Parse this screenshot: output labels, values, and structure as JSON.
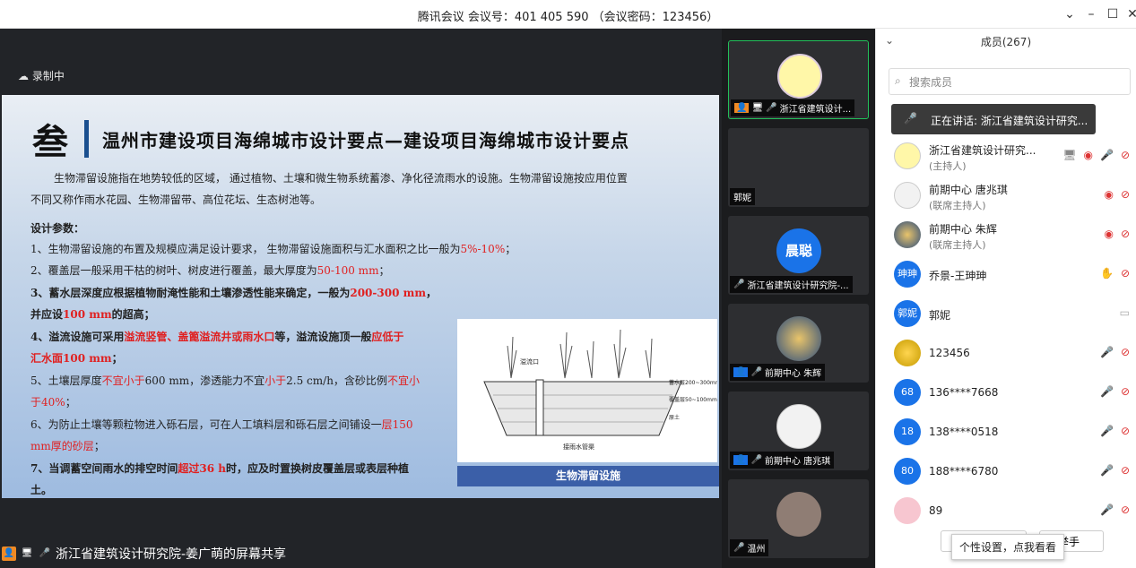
{
  "window": {
    "title": "腾讯会议 会议号：401 405 590 （会议密码：123456）"
  },
  "recording": {
    "label": "录制中"
  },
  "slide": {
    "big_char": "叁",
    "title": "温州市建设项目海绵城市设计要点—建设项目海绵城市设计要点",
    "intro1": "生物滞留设施指在地势较低的区域，  通过植物、土壤和微生物系统蓄渗、净化径流雨水的设施。生物滞留设施按应用位置",
    "intro2": "不同又称作雨水花园、生物滞留带、高位花坛、生态树池等。",
    "params": "设计参数：",
    "l1a": "1、生物滞留设施的布置及规模应满足设计要求， 生物滞留设施面积与汇水面积之比一般为",
    "l1b": "5%-10%",
    "l1c": "；",
    "l2a": "2、覆盖层一般采用干枯的树叶、树皮进行覆盖，最大厚度为",
    "l2b": "50-100 mm",
    "l2c": "；",
    "l3a": "3、蓄水层深度应根据植物耐淹性能和土壤渗透性能来确定，一般为",
    "l3b": "200-300 mm",
    "l3c": "，",
    "l3d": "并应设",
    "l3e": "100 mm",
    "l3f": "的超高；",
    "l4a": "4、溢流设施可采用",
    "l4b": "溢流竖管、盖篦溢流井或雨水口",
    "l4c": "等，溢流设施顶一般",
    "l4d": "应低于",
    "l4e": "汇水面100 mm",
    "l4f": "；",
    "l5a": "5、土壤层厚度",
    "l5b": "不宜小于",
    "l5c": "600 mm，渗透能力不宜",
    "l5d": "小于",
    "l5e": "2.5 cm/h，含砂比例",
    "l5f": "不宜小",
    "l5g": "于40%",
    "l5h": "；",
    "l6a": "6、为防止土壤等颗粒物进入砾石层，可在人工填料层和砾石层之间铺设一",
    "l6b": "层150",
    "l6c": "mm厚的砂层",
    "l6d": "；",
    "l7a": "7、当调蓄空间雨水的排空时间",
    "l7b": "超过36 h",
    "l7c": "时，应及时置换树皮覆盖层或表层种植",
    "l7d": "土。",
    "diagram": {
      "overflow": "溢流口",
      "layer1": "蓄水层200~300mm",
      "layer2": "覆盖层50~100mm",
      "layer3": "原土",
      "drain": "接雨水管渠"
    },
    "caption": "生物滞留设施"
  },
  "sharebar": {
    "label": "浙江省建筑设计研究院-姜广萌的屏幕共享"
  },
  "videos": [
    {
      "name": "浙江省建筑设计...",
      "avatar": "smiley"
    },
    {
      "name": "郭妮",
      "avatar": "none"
    },
    {
      "name": "浙江省建筑设计研究院-...",
      "avatar": "晨聪"
    },
    {
      "name": "前期中心 朱辉",
      "avatar": "painting"
    },
    {
      "name": "前期中心 唐兆琪",
      "avatar": "face"
    },
    {
      "name": "温州",
      "avatar": "photo"
    }
  ],
  "panel": {
    "title": "成员(267)",
    "search_placeholder": "搜索成员",
    "speaking": "正在讲话: 浙江省建筑设计研究...",
    "members": [
      {
        "name": "浙江省建筑设计研究...",
        "role": "(主持人)",
        "avatar": "smiley"
      },
      {
        "name": "前期中心 唐兆琪",
        "role": "(联席主持人)",
        "avatar": "face"
      },
      {
        "name": "前期中心 朱辉",
        "role": "(联席主持人)",
        "avatar": "painting"
      },
      {
        "name": "乔景-王珅珅",
        "role": "",
        "avatar": "珅珅"
      },
      {
        "name": "郭妮",
        "role": "",
        "avatar": "郭妮"
      },
      {
        "name": "123456",
        "role": "",
        "avatar": "flower"
      },
      {
        "name": "136****7668",
        "role": "",
        "avatar": "68"
      },
      {
        "name": "138****0518",
        "role": "",
        "avatar": "18"
      },
      {
        "name": "188****6780",
        "role": "",
        "avatar": "80"
      },
      {
        "name": "89",
        "role": "",
        "avatar": "pink"
      }
    ],
    "raise_hand": "举手",
    "tooltip": "个性设置，点我看看"
  }
}
